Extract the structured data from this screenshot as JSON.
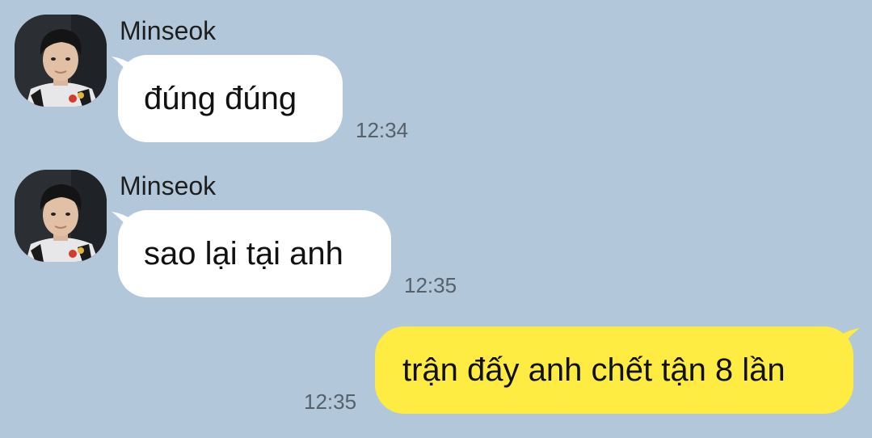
{
  "messages": [
    {
      "sender": "Minseok",
      "text": "đúng đúng",
      "time": "12:34",
      "direction": "incoming"
    },
    {
      "sender": "Minseok",
      "text": "sao lại tại anh",
      "time": "12:35",
      "direction": "incoming"
    },
    {
      "sender": "",
      "text": "trận đấy anh chết tận 8 lần",
      "time": "12:35",
      "direction": "outgoing"
    }
  ],
  "colors": {
    "background": "#b2c7da",
    "incoming_bubble": "#ffffff",
    "outgoing_bubble": "#ffec42",
    "time_text": "#55616b"
  },
  "icons": [
    "avatar-photo"
  ]
}
